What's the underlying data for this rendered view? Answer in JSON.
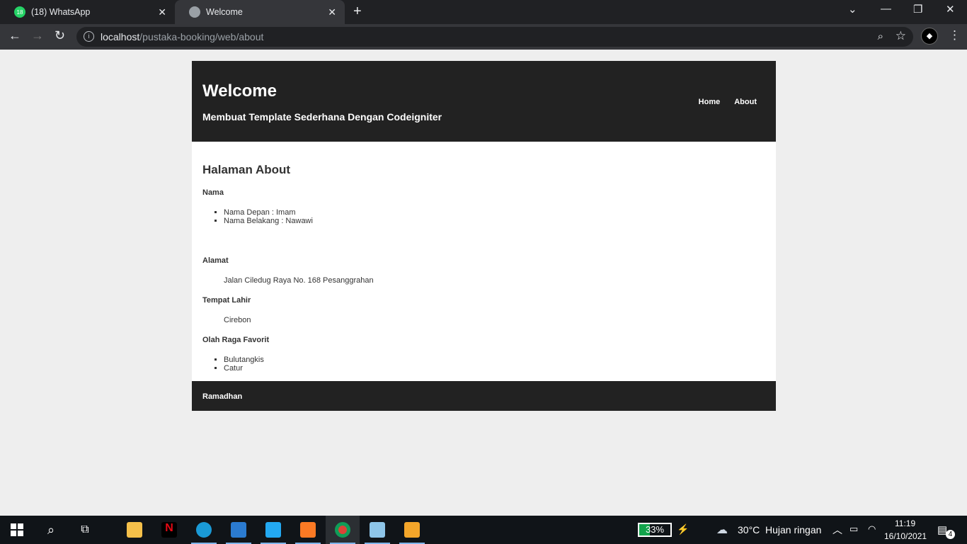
{
  "browser": {
    "tabs": [
      {
        "label": "(18) WhatsApp",
        "badge": "18"
      },
      {
        "label": "Welcome"
      }
    ],
    "url_host": "localhost",
    "url_path": "/pustaka-booking/web/about"
  },
  "page": {
    "title": "Welcome",
    "subtitle": "Membuat Template Sederhana Dengan Codeigniter",
    "menu": [
      "Home",
      "About"
    ],
    "heading": "Halaman About",
    "nama_label": "Nama",
    "nama_items": [
      "Nama Depan : Imam",
      "Nama Belakang : Nawawi"
    ],
    "alamat_label": "Alamat",
    "alamat_value": "Jalan Ciledug Raya No. 168 Pesanggrahan",
    "tempat_lahir_label": "Tempat Lahir",
    "tempat_lahir_value": "Cirebon",
    "olahraga_label": "Olah Raga Favorit",
    "olahraga_items": [
      "Bulutangkis",
      "Catur"
    ],
    "footer": "Ramadhan"
  },
  "taskbar": {
    "battery": "33%",
    "battery_level": 0.33,
    "weather_temp": "30°C",
    "weather_desc": "Hujan ringan",
    "time": "11:19",
    "date": "16/10/2021",
    "notifications": "4"
  }
}
